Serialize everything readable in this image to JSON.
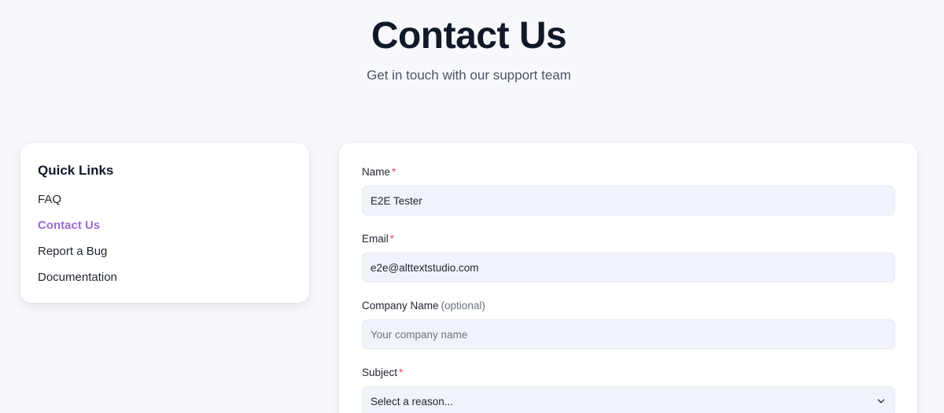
{
  "header": {
    "title": "Contact Us",
    "subtitle": "Get in touch with our support team"
  },
  "sidebar": {
    "title": "Quick Links",
    "links": [
      {
        "label": "FAQ",
        "active": false
      },
      {
        "label": "Contact Us",
        "active": true
      },
      {
        "label": "Report a Bug",
        "active": false
      },
      {
        "label": "Documentation",
        "active": false
      }
    ]
  },
  "form": {
    "name": {
      "label": "Name",
      "required_mark": "*",
      "value": "E2E Tester"
    },
    "email": {
      "label": "Email",
      "required_mark": "*",
      "value": "e2e@alttextstudio.com"
    },
    "company": {
      "label": "Company Name",
      "optional_text": "(optional)",
      "value": "",
      "placeholder": "Your company name"
    },
    "subject": {
      "label": "Subject",
      "required_mark": "*",
      "selected": "Select a reason..."
    }
  },
  "colors": {
    "background": "#f7f8fc",
    "accent": "#9b6bd0",
    "required": "#e04a5f",
    "input_bg": "#f1f3fb"
  },
  "icons": {
    "subject_select": "chevron-down-icon"
  }
}
